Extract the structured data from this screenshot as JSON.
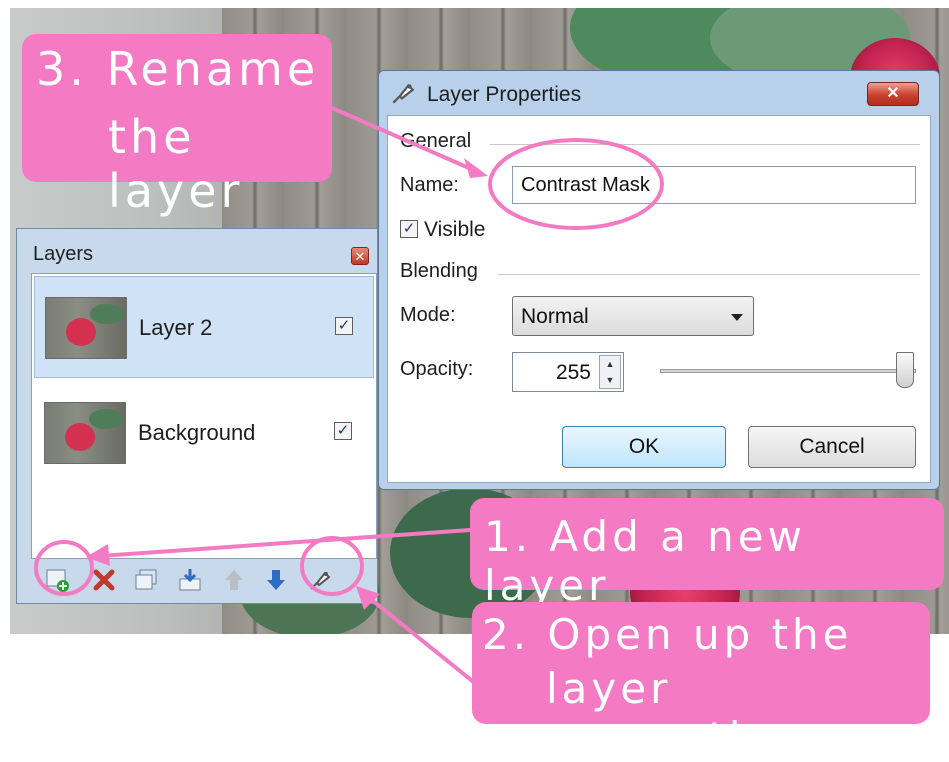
{
  "layers_panel": {
    "title": "Layers",
    "close_glyph": "✕",
    "items": [
      {
        "name": "Layer 2",
        "visible": true,
        "selected": true
      },
      {
        "name": "Background",
        "visible": true,
        "selected": false
      }
    ],
    "toolbar": {
      "add_icon": "add-layer-icon",
      "delete_icon": "delete-layer-icon",
      "duplicate_icon": "duplicate-layer-icon",
      "merge_icon": "merge-down-icon",
      "up_icon": "move-up-icon",
      "down_icon": "move-down-icon",
      "properties_icon": "layer-properties-icon"
    }
  },
  "dialog": {
    "title": "Layer Properties",
    "close_glyph": "✕",
    "general_label": "General",
    "name_label": "Name:",
    "name_value": "Contrast Mask",
    "visible_label": "Visible",
    "visible_checked": true,
    "blending_label": "Blending",
    "mode_label": "Mode:",
    "mode_value": "Normal",
    "opacity_label": "Opacity:",
    "opacity_value": "255",
    "opacity_fraction": 1.0,
    "ok_label": "OK",
    "cancel_label": "Cancel"
  },
  "annotations": {
    "step3_line1": "3. Rename",
    "step3_line2": "the layer",
    "step1": "1. Add a new layer",
    "step2_line1": "2. Open up the",
    "step2_line2": "layer properties",
    "color": "#f47ac4"
  }
}
